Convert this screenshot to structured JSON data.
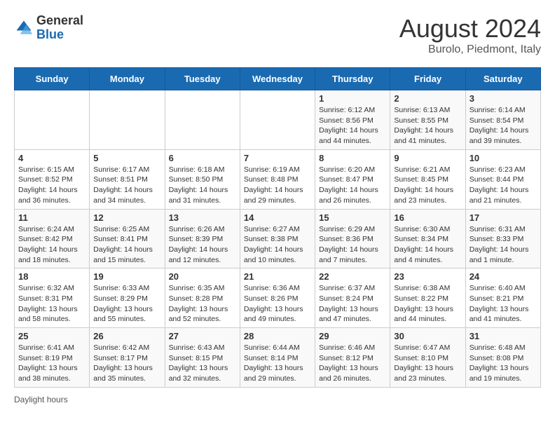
{
  "header": {
    "logo_general": "General",
    "logo_blue": "Blue",
    "month_year": "August 2024",
    "location": "Burolo, Piedmont, Italy"
  },
  "days_of_week": [
    "Sunday",
    "Monday",
    "Tuesday",
    "Wednesday",
    "Thursday",
    "Friday",
    "Saturday"
  ],
  "weeks": [
    [
      {
        "day": null,
        "info": null
      },
      {
        "day": null,
        "info": null
      },
      {
        "day": null,
        "info": null
      },
      {
        "day": null,
        "info": null
      },
      {
        "day": "1",
        "info": "Sunrise: 6:12 AM\nSunset: 8:56 PM\nDaylight: 14 hours and 44 minutes."
      },
      {
        "day": "2",
        "info": "Sunrise: 6:13 AM\nSunset: 8:55 PM\nDaylight: 14 hours and 41 minutes."
      },
      {
        "day": "3",
        "info": "Sunrise: 6:14 AM\nSunset: 8:54 PM\nDaylight: 14 hours and 39 minutes."
      }
    ],
    [
      {
        "day": "4",
        "info": "Sunrise: 6:15 AM\nSunset: 8:52 PM\nDaylight: 14 hours and 36 minutes."
      },
      {
        "day": "5",
        "info": "Sunrise: 6:17 AM\nSunset: 8:51 PM\nDaylight: 14 hours and 34 minutes."
      },
      {
        "day": "6",
        "info": "Sunrise: 6:18 AM\nSunset: 8:50 PM\nDaylight: 14 hours and 31 minutes."
      },
      {
        "day": "7",
        "info": "Sunrise: 6:19 AM\nSunset: 8:48 PM\nDaylight: 14 hours and 29 minutes."
      },
      {
        "day": "8",
        "info": "Sunrise: 6:20 AM\nSunset: 8:47 PM\nDaylight: 14 hours and 26 minutes."
      },
      {
        "day": "9",
        "info": "Sunrise: 6:21 AM\nSunset: 8:45 PM\nDaylight: 14 hours and 23 minutes."
      },
      {
        "day": "10",
        "info": "Sunrise: 6:23 AM\nSunset: 8:44 PM\nDaylight: 14 hours and 21 minutes."
      }
    ],
    [
      {
        "day": "11",
        "info": "Sunrise: 6:24 AM\nSunset: 8:42 PM\nDaylight: 14 hours and 18 minutes."
      },
      {
        "day": "12",
        "info": "Sunrise: 6:25 AM\nSunset: 8:41 PM\nDaylight: 14 hours and 15 minutes."
      },
      {
        "day": "13",
        "info": "Sunrise: 6:26 AM\nSunset: 8:39 PM\nDaylight: 14 hours and 12 minutes."
      },
      {
        "day": "14",
        "info": "Sunrise: 6:27 AM\nSunset: 8:38 PM\nDaylight: 14 hours and 10 minutes."
      },
      {
        "day": "15",
        "info": "Sunrise: 6:29 AM\nSunset: 8:36 PM\nDaylight: 14 hours and 7 minutes."
      },
      {
        "day": "16",
        "info": "Sunrise: 6:30 AM\nSunset: 8:34 PM\nDaylight: 14 hours and 4 minutes."
      },
      {
        "day": "17",
        "info": "Sunrise: 6:31 AM\nSunset: 8:33 PM\nDaylight: 14 hours and 1 minute."
      }
    ],
    [
      {
        "day": "18",
        "info": "Sunrise: 6:32 AM\nSunset: 8:31 PM\nDaylight: 13 hours and 58 minutes."
      },
      {
        "day": "19",
        "info": "Sunrise: 6:33 AM\nSunset: 8:29 PM\nDaylight: 13 hours and 55 minutes."
      },
      {
        "day": "20",
        "info": "Sunrise: 6:35 AM\nSunset: 8:28 PM\nDaylight: 13 hours and 52 minutes."
      },
      {
        "day": "21",
        "info": "Sunrise: 6:36 AM\nSunset: 8:26 PM\nDaylight: 13 hours and 49 minutes."
      },
      {
        "day": "22",
        "info": "Sunrise: 6:37 AM\nSunset: 8:24 PM\nDaylight: 13 hours and 47 minutes."
      },
      {
        "day": "23",
        "info": "Sunrise: 6:38 AM\nSunset: 8:22 PM\nDaylight: 13 hours and 44 minutes."
      },
      {
        "day": "24",
        "info": "Sunrise: 6:40 AM\nSunset: 8:21 PM\nDaylight: 13 hours and 41 minutes."
      }
    ],
    [
      {
        "day": "25",
        "info": "Sunrise: 6:41 AM\nSunset: 8:19 PM\nDaylight: 13 hours and 38 minutes."
      },
      {
        "day": "26",
        "info": "Sunrise: 6:42 AM\nSunset: 8:17 PM\nDaylight: 13 hours and 35 minutes."
      },
      {
        "day": "27",
        "info": "Sunrise: 6:43 AM\nSunset: 8:15 PM\nDaylight: 13 hours and 32 minutes."
      },
      {
        "day": "28",
        "info": "Sunrise: 6:44 AM\nSunset: 8:14 PM\nDaylight: 13 hours and 29 minutes."
      },
      {
        "day": "29",
        "info": "Sunrise: 6:46 AM\nSunset: 8:12 PM\nDaylight: 13 hours and 26 minutes."
      },
      {
        "day": "30",
        "info": "Sunrise: 6:47 AM\nSunset: 8:10 PM\nDaylight: 13 hours and 23 minutes."
      },
      {
        "day": "31",
        "info": "Sunrise: 6:48 AM\nSunset: 8:08 PM\nDaylight: 13 hours and 19 minutes."
      }
    ]
  ],
  "legend": {
    "daylight_hours": "Daylight hours"
  }
}
